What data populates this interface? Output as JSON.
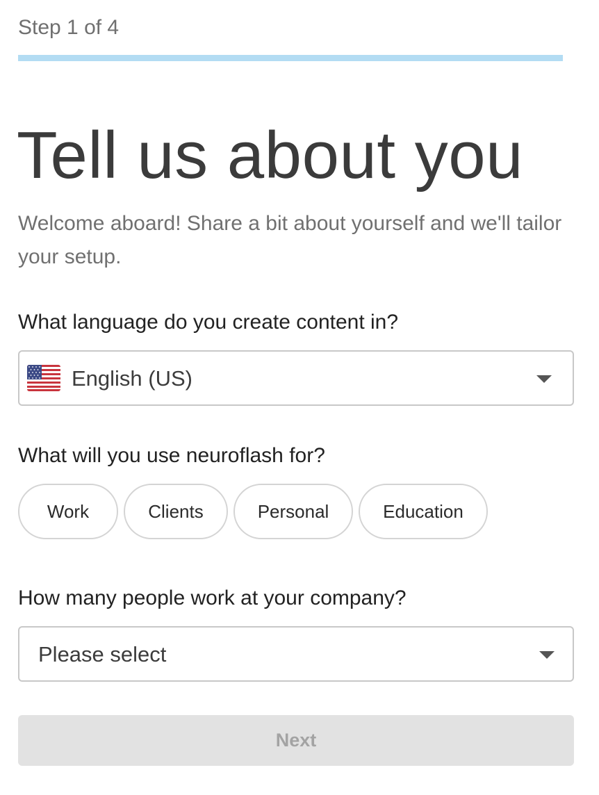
{
  "header": {
    "step_label": "Step 1 of 4",
    "progress": 0.25,
    "progress_color": "#b3dcf3"
  },
  "main": {
    "title": "Tell us about you",
    "subtitle": "Welcome aboard! Share a bit about yourself and we'll tailor your setup."
  },
  "language": {
    "question": "What language do you create content in?",
    "selected": "English (US)",
    "flag_icon": "us-flag-icon",
    "caret_icon": "caret-down-icon"
  },
  "usage": {
    "question": "What will you use neuroflash for?",
    "options": [
      "Work",
      "Clients",
      "Personal",
      "Education"
    ]
  },
  "company_size": {
    "question": "How many people work at your company?",
    "placeholder": "Please select",
    "caret_icon": "caret-down-icon"
  },
  "footer": {
    "next_label": "Next",
    "next_disabled": true
  },
  "colors": {
    "text_primary": "#3b3b3b",
    "text_muted": "#707070",
    "border": "#c8c8c8",
    "button_disabled_bg": "#e2e2e2",
    "button_disabled_text": "#a3a3a3"
  }
}
